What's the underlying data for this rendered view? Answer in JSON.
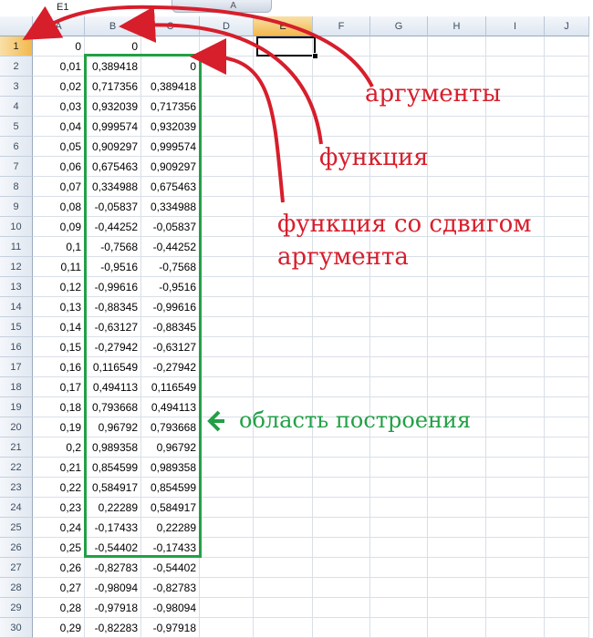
{
  "name_box": "E1",
  "formula_bar_text": "A",
  "columns": [
    "A",
    "B",
    "C",
    "D",
    "E",
    "F",
    "G",
    "H",
    "I",
    "J"
  ],
  "active_column": "E",
  "rows": [
    {
      "n": "1",
      "a": "0",
      "b": "0",
      "c": ""
    },
    {
      "n": "2",
      "a": "0,01",
      "b": "0,389418",
      "c": "0"
    },
    {
      "n": "3",
      "a": "0,02",
      "b": "0,717356",
      "c": "0,389418"
    },
    {
      "n": "4",
      "a": "0,03",
      "b": "0,932039",
      "c": "0,717356"
    },
    {
      "n": "5",
      "a": "0,04",
      "b": "0,999574",
      "c": "0,932039"
    },
    {
      "n": "6",
      "a": "0,05",
      "b": "0,909297",
      "c": "0,999574"
    },
    {
      "n": "7",
      "a": "0,06",
      "b": "0,675463",
      "c": "0,909297"
    },
    {
      "n": "8",
      "a": "0,07",
      "b": "0,334988",
      "c": "0,675463"
    },
    {
      "n": "9",
      "a": "0,08",
      "b": "-0,05837",
      "c": "0,334988"
    },
    {
      "n": "10",
      "a": "0,09",
      "b": "-0,44252",
      "c": "-0,05837"
    },
    {
      "n": "11",
      "a": "0,1",
      "b": "-0,7568",
      "c": "-0,44252"
    },
    {
      "n": "12",
      "a": "0,11",
      "b": "-0,9516",
      "c": "-0,7568"
    },
    {
      "n": "13",
      "a": "0,12",
      "b": "-0,99616",
      "c": "-0,9516"
    },
    {
      "n": "14",
      "a": "0,13",
      "b": "-0,88345",
      "c": "-0,99616"
    },
    {
      "n": "15",
      "a": "0,14",
      "b": "-0,63127",
      "c": "-0,88345"
    },
    {
      "n": "16",
      "a": "0,15",
      "b": "-0,27942",
      "c": "-0,63127"
    },
    {
      "n": "17",
      "a": "0,16",
      "b": "0,116549",
      "c": "-0,27942"
    },
    {
      "n": "18",
      "a": "0,17",
      "b": "0,494113",
      "c": "0,116549"
    },
    {
      "n": "19",
      "a": "0,18",
      "b": "0,793668",
      "c": "0,494113"
    },
    {
      "n": "20",
      "a": "0,19",
      "b": "0,96792",
      "c": "0,793668"
    },
    {
      "n": "21",
      "a": "0,2",
      "b": "0,989358",
      "c": "0,96792"
    },
    {
      "n": "22",
      "a": "0,21",
      "b": "0,854599",
      "c": "0,989358"
    },
    {
      "n": "23",
      "a": "0,22",
      "b": "0,584917",
      "c": "0,854599"
    },
    {
      "n": "24",
      "a": "0,23",
      "b": "0,22289",
      "c": "0,584917"
    },
    {
      "n": "25",
      "a": "0,24",
      "b": "-0,17433",
      "c": "0,22289"
    },
    {
      "n": "26",
      "a": "0,25",
      "b": "-0,54402",
      "c": "-0,17433"
    },
    {
      "n": "27",
      "a": "0,26",
      "b": "-0,82783",
      "c": "-0,54402"
    },
    {
      "n": "28",
      "a": "0,27",
      "b": "-0,98094",
      "c": "-0,82783"
    },
    {
      "n": "29",
      "a": "0,28",
      "b": "-0,97918",
      "c": "-0,98094"
    },
    {
      "n": "30",
      "a": "0,29",
      "b": "-0,82283",
      "c": "-0,97918"
    }
  ],
  "annotations": {
    "arguments": "аргументы",
    "function": "функция",
    "shifted_line1": "функция со сдвигом",
    "shifted_line2": "аргумента",
    "plot_area": "область построения"
  },
  "colors": {
    "red": "#d71e2b",
    "green": "#22a046"
  }
}
